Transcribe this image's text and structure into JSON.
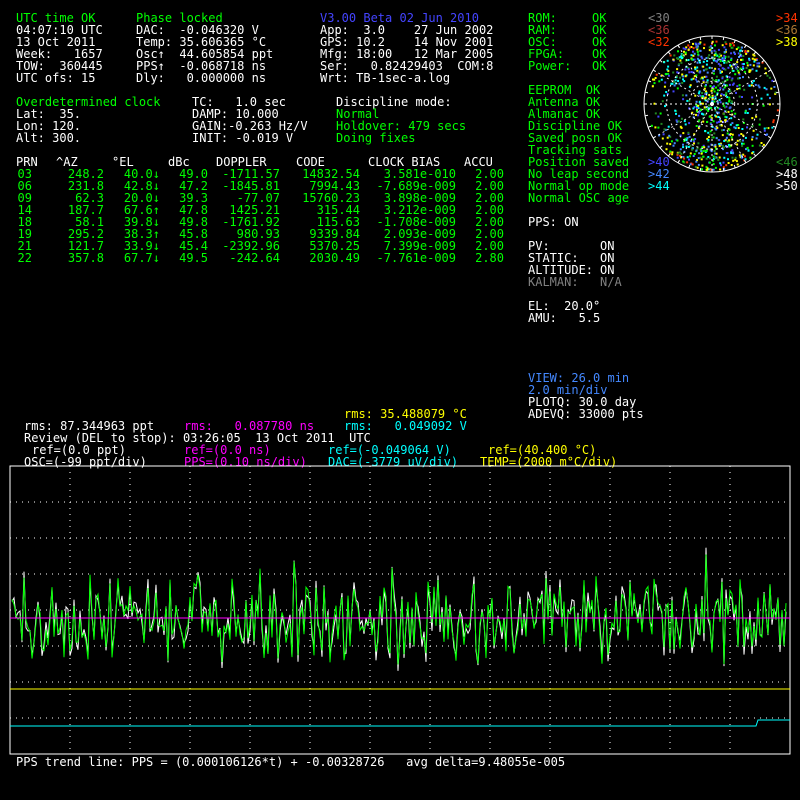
{
  "status": {
    "utc_time_ok": "UTC time OK",
    "time_line": "04:07:10 UTC",
    "date_line": "13 Oct 2011",
    "week": "Week:   1657",
    "tow": "TOW:  360445",
    "utc_ofs": "UTC ofs: 15"
  },
  "phase": {
    "phase_locked": "Phase locked",
    "dac": "DAC:  -0.046320 V",
    "temp": "Temp: 35.606365 °C",
    "osc": "Osc↑  44.605854 ppt",
    "pps": "PPS↑  -0.068718 ns",
    "dly": "Dly:   0.000000 ns"
  },
  "version": {
    "title": "V3.00 Beta 02 Jun 2010",
    "app": "App:  3.0    27 Jun 2002",
    "gps": "GPS: 10.2    14 Nov 2001",
    "mfg": "Mfg: 18:00   12 Mar 2005",
    "ser": "Ser:   0.82429403  COM:8",
    "wrt": "Wrt: TB-1sec-a.log"
  },
  "health": [
    {
      "label": "ROM:",
      "value": "OK"
    },
    {
      "label": "RAM:",
      "value": "OK"
    },
    {
      "label": "OSC:",
      "value": "OK"
    },
    {
      "label": "FPGA:",
      "value": "OK"
    },
    {
      "label": "Power:",
      "value": "OK"
    }
  ],
  "status_lines": [
    {
      "text": "EEPROM  OK",
      "color": "#00ff00"
    },
    {
      "text": "Antenna OK",
      "color": "#00ff00"
    },
    {
      "text": "Almanac OK",
      "color": "#00ff00"
    },
    {
      "text": "Discipline OK",
      "color": "#00ff00"
    },
    {
      "text": "Saved posn OK",
      "color": "#00ff00"
    },
    {
      "text": "Tracking sats",
      "color": "#00ff00"
    },
    {
      "text": "Position saved",
      "color": "#00ff00"
    },
    {
      "text": "No leap second",
      "color": "#00ff00"
    },
    {
      "text": "Normal op mode",
      "color": "#00ff00"
    },
    {
      "text": "Normal OSC age",
      "color": "#00ff00"
    }
  ],
  "pps_on": "PPS: ON",
  "pv_block": [
    {
      "label": "PV:",
      "value": "ON",
      "color": "#ffffff"
    },
    {
      "label": "STATIC:",
      "value": "ON",
      "color": "#ffffff"
    },
    {
      "label": "ALTITUDE:",
      "value": "ON",
      "color": "#ffffff"
    },
    {
      "label": "KALMAN:",
      "value": "N/A",
      "color": "#808080"
    }
  ],
  "el": "EL:  20.0°",
  "amu": "AMU:   5.5",
  "clock": {
    "title": "Overdetermined clock",
    "lat": "Lat:  35.",
    "lon": "Lon: 120.",
    "alt": "Alt: 300.",
    "tc": "TC:   1.0 sec",
    "damp": "DAMP: 10.000",
    "gain": "GAIN:-0.263 Hz/V",
    "init": "INIT: -0.019 V",
    "discipline_title": "Discipline mode:",
    "discipline_lines": [
      "Normal",
      "Holdover: 479 secs",
      "Doing fixes"
    ]
  },
  "sat_table": {
    "headers": [
      "PRN",
      "^AZ",
      "°EL",
      "dBc",
      "DOPPLER",
      "CODE",
      "CLOCK BIAS",
      "ACCU"
    ],
    "rows": [
      [
        "03",
        "248.2",
        "40.0↓",
        "49.0",
        "-1711.57",
        "14832.54",
        "3.581e-010",
        "2.00"
      ],
      [
        "06",
        "231.8",
        "42.8↓",
        "47.2",
        "-1845.81",
        "7994.43",
        "-7.689e-009",
        "2.00"
      ],
      [
        "09",
        "62.3",
        "20.0↓",
        "39.3",
        "-77.07",
        "15760.23",
        "3.898e-009",
        "2.00"
      ],
      [
        "14",
        "187.7",
        "67.6↑",
        "47.8",
        "1425.21",
        "315.44",
        "3.212e-009",
        "2.00"
      ],
      [
        "18",
        "58.1",
        "39.8↓",
        "49.8",
        "-1761.92",
        "115.63",
        "-1.708e-009",
        "2.00"
      ],
      [
        "19",
        "295.2",
        "38.3↑",
        "45.8",
        "980.93",
        "9339.84",
        "2.093e-009",
        "2.00"
      ],
      [
        "21",
        "121.7",
        "33.9↓",
        "45.4",
        "-2392.96",
        "5370.25",
        "7.399e-009",
        "2.00"
      ],
      [
        "22",
        "357.8",
        "67.7↓",
        "49.5",
        "-242.64",
        "2030.49",
        "-7.761e-009",
        "2.80"
      ]
    ]
  },
  "sky_legend": {
    "left": [
      {
        "text": "<30",
        "color": "#808080"
      },
      {
        "text": "<36",
        "color": "#aa3333"
      },
      {
        "text": "<32",
        "color": "#ff3300"
      }
    ],
    "right": [
      {
        "text": ">34",
        "color": "#ff3300"
      },
      {
        "text": "<36",
        "color": "#aa7733"
      },
      {
        "text": ">38",
        "color": "#ffff00"
      }
    ],
    "bottom_left": [
      {
        "text": ">40",
        "color": "#4444ff"
      },
      {
        "text": ">42",
        "color": "#4488ff"
      },
      {
        "text": ">44",
        "color": "#00ffff"
      }
    ],
    "bottom_right": [
      {
        "text": "<46",
        "color": "#228822"
      },
      {
        "text": ">48",
        "color": "#ffffff"
      },
      {
        "text": ">50",
        "color": "#ffffff"
      }
    ]
  },
  "view": {
    "view": "VIEW: 26.0 min",
    "min_div": "2.0 min/div",
    "plotq": "PLOTQ: 30.0 day",
    "adevq": "ADEVQ: 33000 pts"
  },
  "plot_stats": {
    "rms_temp": "rms: 35.488079 °C",
    "rms_osc": "rms: 87.344963 ppt",
    "rms_pps": "rms:   0.087780 ns",
    "rms_dac": "rms:   0.049092 V",
    "review": "Review (DEL to stop): 03:26:05  13 Oct 2011  UTC",
    "ref_osc": "ref=(0.0 ppt)",
    "ref_pps": "ref=(0.0 ns)",
    "ref_dac": "ref=(-0.049064 V)",
    "ref_temp": "ref=(40.400 °C)",
    "osc_scale": "OSC=(-99 ppt/div)",
    "pps_scale": "PPS=(0.10 ns/div)",
    "dac_scale": "DAC=(-3779 uV/div)",
    "temp_scale": "TEMP=(2000 m°C/div)"
  },
  "trend_line": "PPS trend line: PPS = (0.000106126*t) + -0.00328726   avg delta=9.48055e-005",
  "colors": {
    "osc": "#00ff00",
    "pps": "#ff00ff",
    "dac": "#00ffff",
    "temp": "#ffff00",
    "text": "#ffffff",
    "status": "#00ff00",
    "version": "#4444ff"
  }
}
